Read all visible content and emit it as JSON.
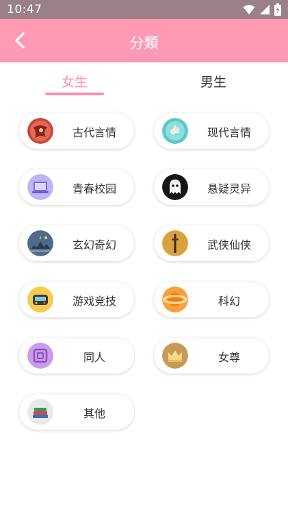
{
  "status_bar": {
    "time": "10:47"
  },
  "header": {
    "title": "分類"
  },
  "tabs": [
    {
      "label": "女生",
      "selected": true
    },
    {
      "label": "男生",
      "selected": false
    }
  ],
  "colors": {
    "accent": "#ff9ab4",
    "tab_active": "#ff8fb0",
    "status_bar": "#9a8087"
  },
  "categories": [
    {
      "label": "古代言情",
      "icon": "ancient-romance-icon"
    },
    {
      "label": "现代言情",
      "icon": "modern-romance-icon"
    },
    {
      "label": "青春校园",
      "icon": "campus-icon"
    },
    {
      "label": "悬疑灵异",
      "icon": "ghost-icon"
    },
    {
      "label": "玄幻奇幻",
      "icon": "fantasy-icon"
    },
    {
      "label": "武侠仙侠",
      "icon": "sword-icon"
    },
    {
      "label": "游戏竞技",
      "icon": "gamepad-icon"
    },
    {
      "label": "科幻",
      "icon": "planet-icon"
    },
    {
      "label": "同人",
      "icon": "fanfic-icon"
    },
    {
      "label": "女尊",
      "icon": "crown-icon"
    },
    {
      "label": "其他",
      "icon": "books-icon"
    }
  ]
}
